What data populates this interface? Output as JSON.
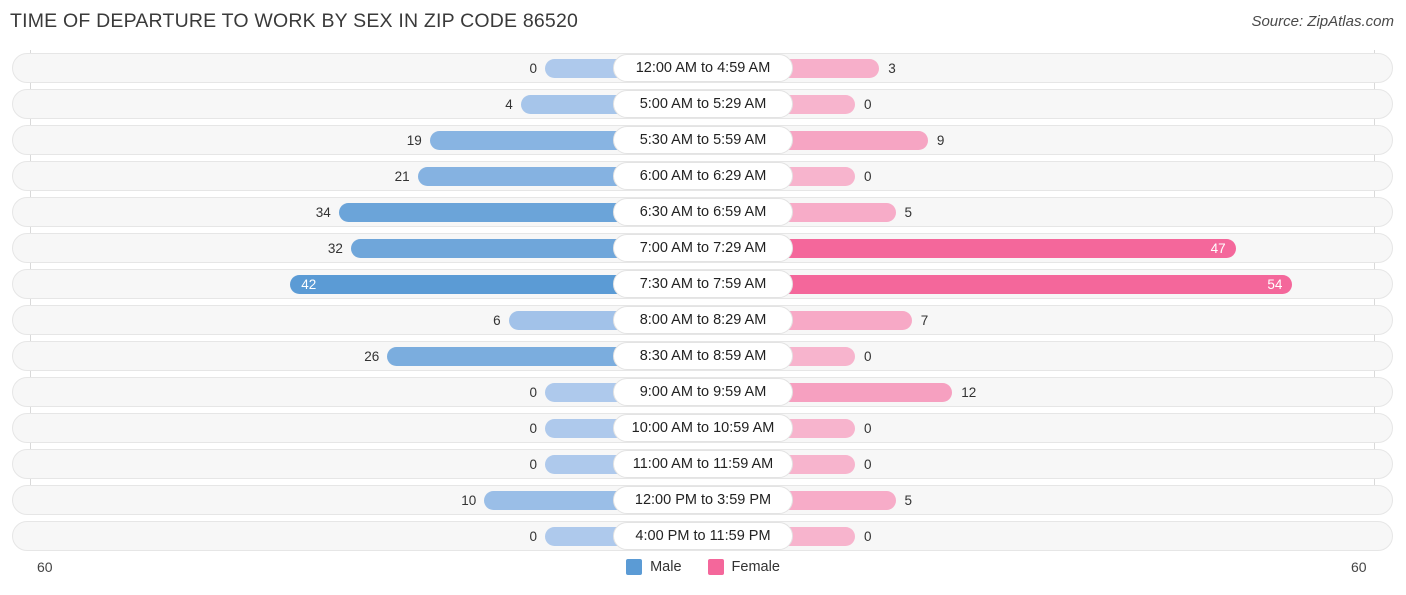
{
  "header": {
    "title": "TIME OF DEPARTURE TO WORK BY SEX IN ZIP CODE 86520",
    "source": "Source: ZipAtlas.com"
  },
  "legend": {
    "male_label": "Male",
    "female_label": "Female",
    "male_color": "#5B9BD5",
    "female_color": "#F4679B"
  },
  "axis": {
    "left_tick": "60",
    "right_tick": "60"
  },
  "chart_data": {
    "type": "bar",
    "subtype": "diverging-bidirectional",
    "title": "TIME OF DEPARTURE TO WORK BY SEX IN ZIP CODE 86520",
    "xlabel": "",
    "ylabel": "",
    "xlim": [
      60,
      60
    ],
    "axis_max": 60,
    "grid": false,
    "legend_position": "bottom-center",
    "categories": [
      "12:00 AM to 4:59 AM",
      "5:00 AM to 5:29 AM",
      "5:30 AM to 5:59 AM",
      "6:00 AM to 6:29 AM",
      "6:30 AM to 6:59 AM",
      "7:00 AM to 7:29 AM",
      "7:30 AM to 7:59 AM",
      "8:00 AM to 8:29 AM",
      "8:30 AM to 8:59 AM",
      "9:00 AM to 9:59 AM",
      "10:00 AM to 10:59 AM",
      "11:00 AM to 11:59 AM",
      "12:00 PM to 3:59 PM",
      "4:00 PM to 11:59 PM"
    ],
    "series": [
      {
        "name": "Male",
        "direction": "left",
        "values": [
          0,
          4,
          19,
          21,
          34,
          32,
          42,
          6,
          26,
          0,
          0,
          0,
          10,
          0
        ]
      },
      {
        "name": "Female",
        "direction": "right",
        "values": [
          3,
          0,
          9,
          0,
          5,
          47,
          54,
          7,
          0,
          12,
          0,
          0,
          5,
          0
        ]
      }
    ]
  },
  "rows": [
    {
      "label": "12:00 AM to 4:59 AM",
      "male": "0",
      "female": "3"
    },
    {
      "label": "5:00 AM to 5:29 AM",
      "male": "4",
      "female": "0"
    },
    {
      "label": "5:30 AM to 5:59 AM",
      "male": "19",
      "female": "9"
    },
    {
      "label": "6:00 AM to 6:29 AM",
      "male": "21",
      "female": "0"
    },
    {
      "label": "6:30 AM to 6:59 AM",
      "male": "34",
      "female": "5"
    },
    {
      "label": "7:00 AM to 7:29 AM",
      "male": "32",
      "female": "47"
    },
    {
      "label": "7:30 AM to 7:59 AM",
      "male": "42",
      "female": "54"
    },
    {
      "label": "8:00 AM to 8:29 AM",
      "male": "6",
      "female": "7"
    },
    {
      "label": "8:30 AM to 8:59 AM",
      "male": "26",
      "female": "0"
    },
    {
      "label": "9:00 AM to 9:59 AM",
      "male": "0",
      "female": "12"
    },
    {
      "label": "10:00 AM to 10:59 AM",
      "male": "0",
      "female": "0"
    },
    {
      "label": "11:00 AM to 11:59 AM",
      "male": "0",
      "female": "0"
    },
    {
      "label": "12:00 PM to 3:59 PM",
      "male": "10",
      "female": "5"
    },
    {
      "label": "4:00 PM to 11:59 PM",
      "male": "0",
      "female": "0"
    }
  ]
}
